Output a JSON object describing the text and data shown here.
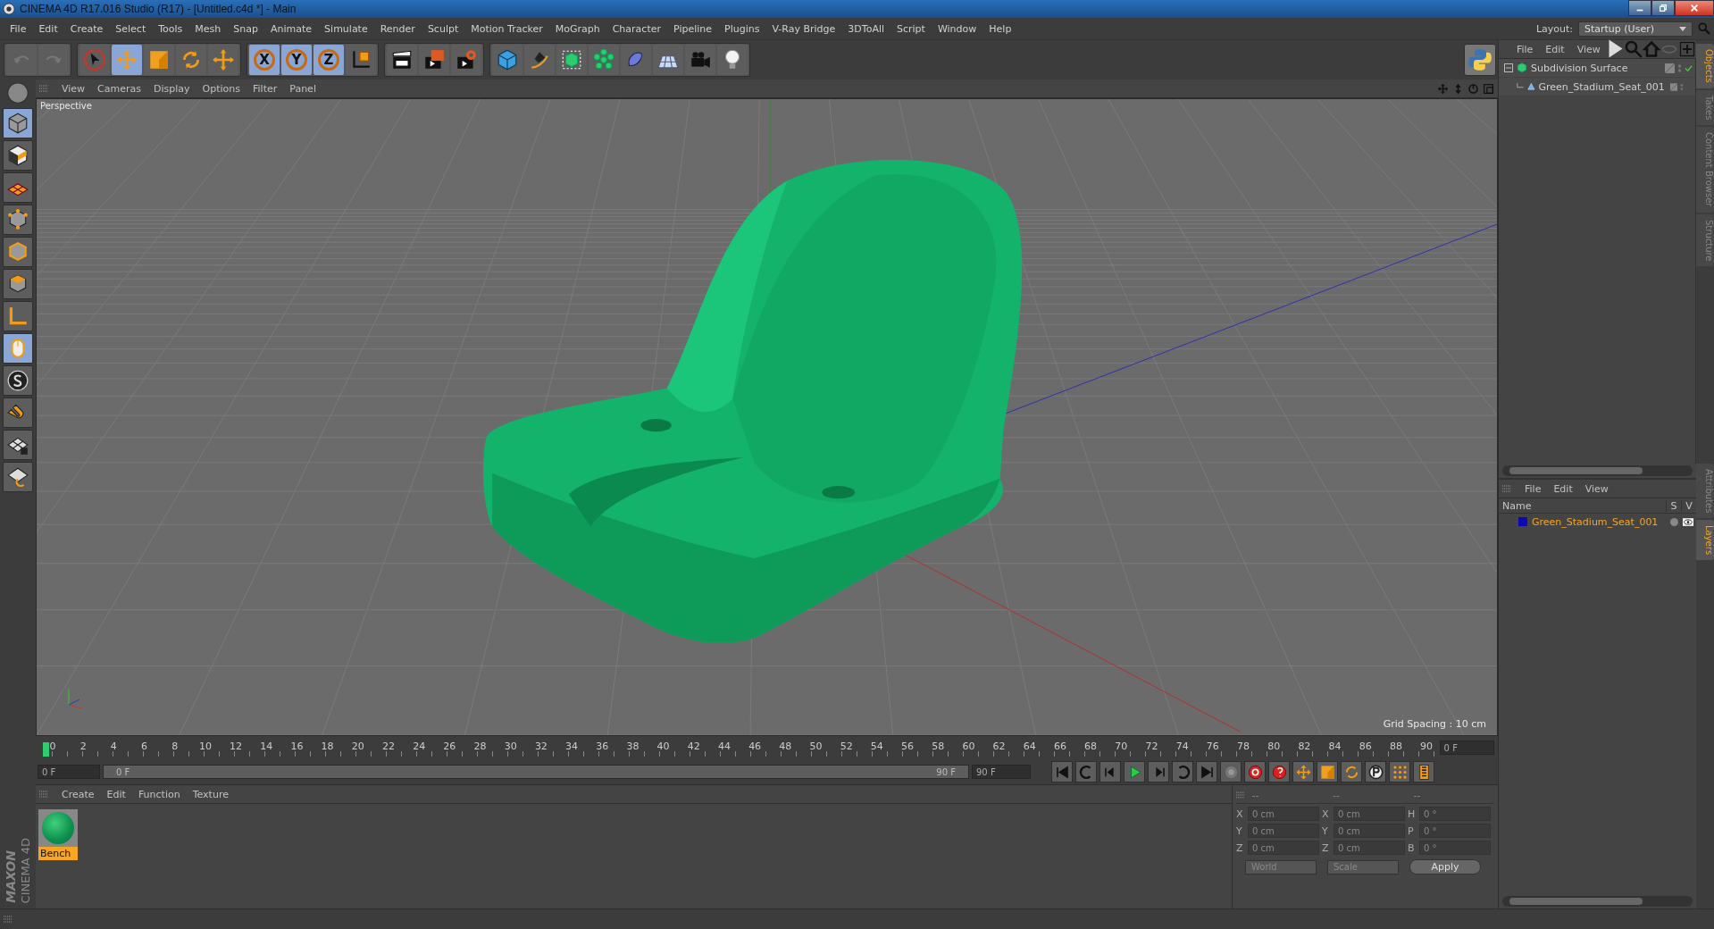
{
  "window": {
    "title": "CINEMA 4D R17.016 Studio (R17) - [Untitled.c4d *] - Main"
  },
  "menu": [
    "File",
    "Edit",
    "Create",
    "Select",
    "Tools",
    "Mesh",
    "Snap",
    "Animate",
    "Simulate",
    "Render",
    "Sculpt",
    "Motion Tracker",
    "MoGraph",
    "Character",
    "Pipeline",
    "Plugins",
    "V-Ray Bridge",
    "3DToAll",
    "Script",
    "Window",
    "Help"
  ],
  "layout": {
    "label": "Layout:",
    "value": "Startup (User)"
  },
  "toolbar": [
    [
      {
        "kind": "undo",
        "selected": false
      },
      {
        "kind": "redo",
        "selected": false
      }
    ],
    [
      {
        "kind": "pointer",
        "selected": false
      },
      {
        "kind": "move",
        "selected": true
      },
      {
        "kind": "scale",
        "selected": false
      },
      {
        "kind": "rotate",
        "selected": false
      },
      {
        "kind": "transform",
        "selected": false
      }
    ],
    [
      {
        "kind": "axis",
        "label": "X",
        "selected": true
      },
      {
        "kind": "axis",
        "label": "Y",
        "selected": true
      },
      {
        "kind": "axis",
        "label": "Z",
        "selected": true
      },
      {
        "kind": "coords",
        "selected": false
      }
    ],
    [
      {
        "kind": "render-view",
        "selected": false
      },
      {
        "kind": "render-picture",
        "selected": false
      },
      {
        "kind": "render-settings",
        "selected": false
      }
    ],
    [
      {
        "kind": "cube",
        "selected": false
      },
      {
        "kind": "pen",
        "selected": false
      },
      {
        "kind": "subdivision",
        "selected": false
      },
      {
        "kind": "cloner",
        "selected": false
      },
      {
        "kind": "deformer",
        "selected": false
      },
      {
        "kind": "floor",
        "selected": false
      },
      {
        "kind": "camera",
        "selected": false
      },
      {
        "kind": "light",
        "selected": false
      }
    ]
  ],
  "left_tools": [
    {
      "kind": "model",
      "selected": true
    },
    {
      "kind": "texture",
      "selected": false
    },
    {
      "kind": "workplane",
      "selected": false
    },
    {
      "kind": "points",
      "selected": false
    },
    {
      "kind": "edges",
      "selected": false
    },
    {
      "kind": "polygons",
      "selected": false
    },
    {
      "kind": "axis-mode",
      "selected": false
    },
    {
      "kind": "tweak",
      "selected": true
    },
    {
      "kind": "snap",
      "selected": false
    },
    {
      "kind": "magnet",
      "selected": false
    },
    {
      "kind": "grid-lock",
      "selected": false
    },
    {
      "kind": "grid-snap",
      "selected": false
    }
  ],
  "viewport": {
    "menu": [
      "View",
      "Cameras",
      "Display",
      "Options",
      "Filter",
      "Panel"
    ],
    "camera": "Perspective",
    "grid_spacing": "Grid Spacing : 10 cm"
  },
  "timeline": {
    "ticks": [
      "0",
      "2",
      "4",
      "6",
      "8",
      "10",
      "12",
      "14",
      "16",
      "18",
      "20",
      "22",
      "24",
      "26",
      "28",
      "30",
      "32",
      "34",
      "36",
      "38",
      "40",
      "42",
      "44",
      "46",
      "48",
      "50",
      "52",
      "54",
      "56",
      "58",
      "60",
      "62",
      "64",
      "66",
      "68",
      "70",
      "72",
      "74",
      "76",
      "78",
      "80",
      "82",
      "84",
      "86",
      "88",
      "90"
    ],
    "frame": "0 F"
  },
  "transport": {
    "start": "0 F",
    "range_start": "0 F",
    "range_end": "90 F",
    "level": 1,
    "end": "90 F",
    "controls": [
      {
        "kind": "first"
      },
      {
        "kind": "prev-key"
      },
      {
        "kind": "prev-frame"
      },
      {
        "kind": "play"
      },
      {
        "kind": "next-frame"
      },
      {
        "kind": "next-key"
      },
      {
        "kind": "last"
      },
      {
        "kind": "record-off"
      },
      {
        "kind": "record"
      },
      {
        "kind": "autokey"
      },
      {
        "kind": "key-move"
      },
      {
        "kind": "key-scale"
      },
      {
        "kind": "key-rotate"
      },
      {
        "kind": "key-param"
      },
      {
        "kind": "key-pla"
      },
      {
        "kind": "timeline"
      }
    ]
  },
  "materials": {
    "menu": [
      "Create",
      "Edit",
      "Function",
      "Texture"
    ],
    "items": [
      {
        "name": "Bench",
        "selected": true
      }
    ]
  },
  "coordinates": {
    "headers": [
      "--",
      "--",
      "--"
    ],
    "rows": [
      {
        "cells": [
          {
            "label": "X",
            "value": "0 cm"
          },
          {
            "label": "X",
            "value": "0 cm"
          },
          {
            "label": "H",
            "value": "0 °"
          }
        ]
      },
      {
        "cells": [
          {
            "label": "Y",
            "value": "0 cm"
          },
          {
            "label": "Y",
            "value": "0 cm"
          },
          {
            "label": "P",
            "value": "0 °"
          }
        ]
      },
      {
        "cells": [
          {
            "label": "Z",
            "value": "0 cm"
          },
          {
            "label": "Z",
            "value": "0 cm"
          },
          {
            "label": "B",
            "value": "0 °"
          }
        ]
      }
    ],
    "space": "World",
    "mode": "Scale",
    "apply": "Apply"
  },
  "objects": {
    "menu": [
      "File",
      "Edit",
      "View"
    ],
    "tree": [
      {
        "name": "Subdivision Surface",
        "kind": "subdivision",
        "expanded": true,
        "enabled": true,
        "children": [
          {
            "name": "Green_Stadium_Seat_001",
            "kind": "polygon",
            "enabled": false
          }
        ]
      }
    ]
  },
  "layers": {
    "menu": [
      "File",
      "Edit",
      "View"
    ],
    "columns": [
      "Name",
      "S",
      "V"
    ],
    "rows": [
      {
        "name": "Green_Stadium_Seat_001",
        "color": "#0a0ab4"
      }
    ]
  },
  "side_tabs": {
    "top": [
      {
        "label": "Objects",
        "selected": true
      },
      {
        "label": "Takes",
        "selected": false
      },
      {
        "label": "Content Browser",
        "selected": false
      },
      {
        "label": "Structure",
        "selected": false
      }
    ],
    "bottom": [
      {
        "label": "Attributes",
        "selected": false
      },
      {
        "label": "Layers",
        "selected": true
      }
    ]
  },
  "brand": {
    "maker": "MAXON",
    "product": "CINEMA 4D"
  }
}
